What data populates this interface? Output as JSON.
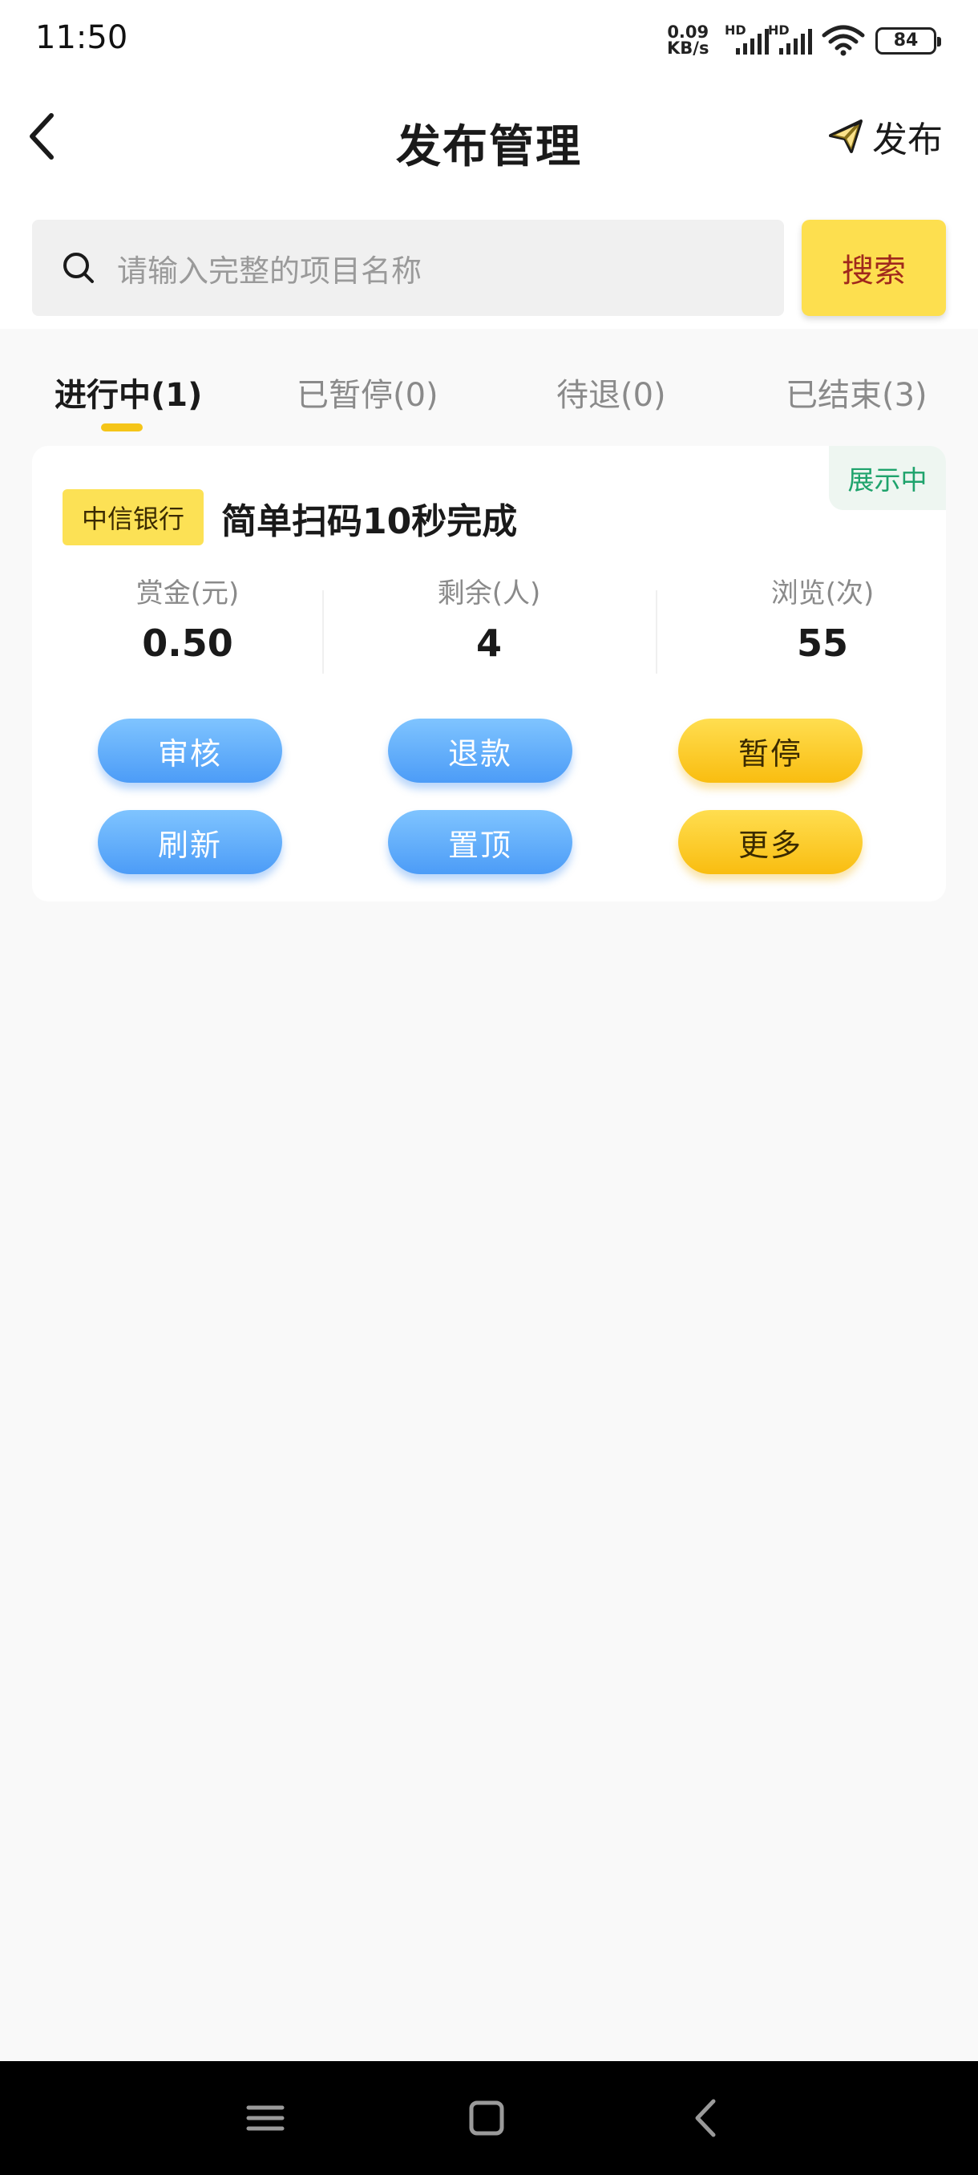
{
  "status_bar": {
    "time": "11:50",
    "net_speed_value": "0.09",
    "net_speed_unit": "KB/s",
    "sim1": "HD",
    "sim2": "HD",
    "battery": "84"
  },
  "header": {
    "title": "发布管理",
    "publish_label": "发布",
    "back_icon": "chevron-left-icon",
    "publish_icon": "paper-plane-icon"
  },
  "search": {
    "placeholder": "请输入完整的项目名称",
    "button_label": "搜索",
    "icon": "search-icon"
  },
  "tabs": [
    {
      "label": "进行中(1)",
      "active": true
    },
    {
      "label": "已暂停(0)",
      "active": false
    },
    {
      "label": "待退(0)",
      "active": false
    },
    {
      "label": "已结束(3)",
      "active": false
    }
  ],
  "tasks": [
    {
      "bank": "中信银行",
      "title": "简单扫码10秒完成",
      "status": "展示中",
      "stats": [
        {
          "label": "赏金(元)",
          "value": "0.50"
        },
        {
          "label": "剩余(人)",
          "value": "4"
        },
        {
          "label": "浏览(次)",
          "value": "55"
        }
      ],
      "actions": {
        "review": "审核",
        "refund": "退款",
        "pause": "暂停",
        "refresh": "刷新",
        "pin": "置顶",
        "more": "更多"
      }
    }
  ],
  "colors": {
    "accent_yellow": "#fddf4f",
    "button_blue": "#4c9cf7",
    "status_green": "#1ea36c",
    "search_text_red": "#a0281c"
  },
  "nav_bar": {
    "menu_icon": "menu-icon",
    "home_icon": "home-square-icon",
    "back_icon": "back-chevron-icon"
  }
}
